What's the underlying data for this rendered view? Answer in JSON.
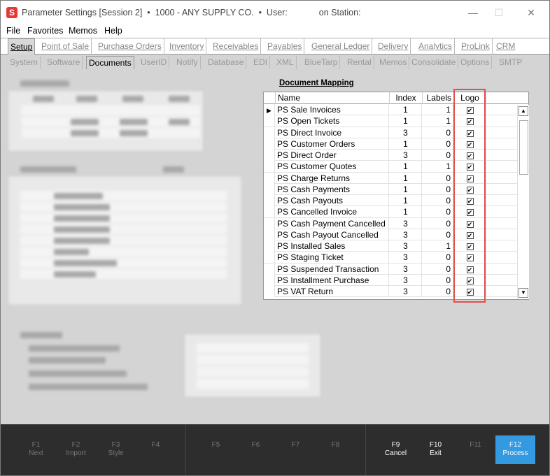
{
  "window": {
    "app_title": "Parameter Settings [Session 2]",
    "company": "1000 - ANY SUPPLY CO.",
    "user_label": "User:",
    "station_label": "on Station:"
  },
  "menu": [
    "File",
    "Favorites",
    "Memos",
    "Help"
  ],
  "main_tabs": [
    "Setup",
    "Point of Sale",
    "Purchase Orders",
    "Inventory",
    "Receivables",
    "Payables",
    "General Ledger",
    "Delivery",
    "Analytics",
    "ProLink",
    "CRM"
  ],
  "sub_tabs": [
    "System",
    "Software",
    "Documents",
    "UserID",
    "Notify",
    "Database",
    "EDI",
    "XML",
    "BlueTarp",
    "Rental",
    "Memos",
    "Consolidate",
    "Options",
    "SMTP"
  ],
  "document_mapping": {
    "title": "Document Mapping",
    "columns": {
      "name": "Name",
      "index": "Index",
      "labels": "Labels",
      "logo": "Logo"
    },
    "rows": [
      {
        "name": "PS Sale Invoices",
        "index": "1",
        "labels": "1",
        "logo": "✔"
      },
      {
        "name": "PS Open Tickets",
        "index": "1",
        "labels": "1",
        "logo": "✔"
      },
      {
        "name": "PS Direct Invoice",
        "index": "3",
        "labels": "0",
        "logo": "✔"
      },
      {
        "name": "PS Customer Orders",
        "index": "1",
        "labels": "0",
        "logo": "✔"
      },
      {
        "name": "PS Direct Order",
        "index": "3",
        "labels": "0",
        "logo": "✔"
      },
      {
        "name": "PS Customer Quotes",
        "index": "1",
        "labels": "1",
        "logo": "✔"
      },
      {
        "name": "PS Charge Returns",
        "index": "1",
        "labels": "0",
        "logo": "✔"
      },
      {
        "name": "PS Cash Payments",
        "index": "1",
        "labels": "0",
        "logo": "✔"
      },
      {
        "name": "PS Cash Payouts",
        "index": "1",
        "labels": "0",
        "logo": "✔"
      },
      {
        "name": "PS Cancelled Invoice",
        "index": "1",
        "labels": "0",
        "logo": "✔"
      },
      {
        "name": "PS Cash Payment Cancelled",
        "index": "3",
        "labels": "0",
        "logo": "✔"
      },
      {
        "name": "PS Cash Payout Cancelled",
        "index": "3",
        "labels": "0",
        "logo": "✔"
      },
      {
        "name": "PS Installed Sales",
        "index": "3",
        "labels": "1",
        "logo": "✔"
      },
      {
        "name": "PS Staging Ticket",
        "index": "3",
        "labels": "0",
        "logo": "✔"
      },
      {
        "name": "PS Suspended Transaction",
        "index": "3",
        "labels": "0",
        "logo": "✔"
      },
      {
        "name": "PS Installment Purchase",
        "index": "3",
        "labels": "0",
        "logo": "✔"
      },
      {
        "name": "PS VAT Return",
        "index": "3",
        "labels": "0",
        "logo": "✔"
      }
    ]
  },
  "fkeys": [
    {
      "key": "F1",
      "label": "Next"
    },
    {
      "key": "F2",
      "label": "Import"
    },
    {
      "key": "F3",
      "label": "Style"
    },
    {
      "key": "F4",
      "label": ""
    },
    {
      "key": "F5",
      "label": ""
    },
    {
      "key": "F6",
      "label": ""
    },
    {
      "key": "F7",
      "label": ""
    },
    {
      "key": "F8",
      "label": ""
    },
    {
      "key": "F9",
      "label": "Cancel"
    },
    {
      "key": "F10",
      "label": "Exit"
    },
    {
      "key": "F11",
      "label": ""
    },
    {
      "key": "F12",
      "label": "Process"
    }
  ],
  "colors": {
    "accent": "#3399e0",
    "highlight_border": "#e05050",
    "app_icon": "#e53935"
  }
}
